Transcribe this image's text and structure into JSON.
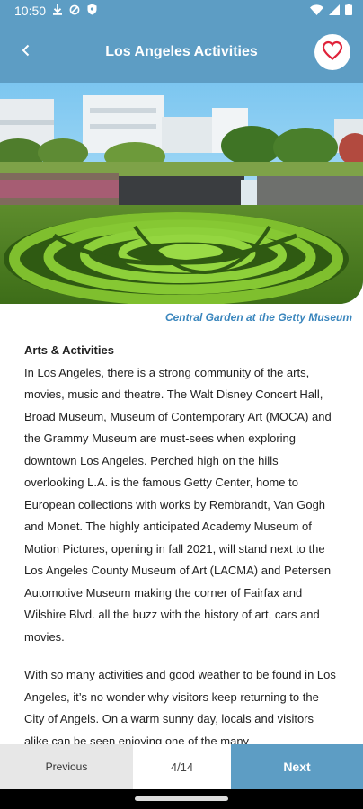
{
  "status_bar": {
    "time": "10:50",
    "left_icons": [
      "download-icon",
      "data-saver-icon",
      "shield-icon"
    ],
    "right_icons": [
      "wifi-icon",
      "signal-icon",
      "battery-icon"
    ]
  },
  "app_bar": {
    "title": "Los Angeles Activities",
    "back_icon": "chevron-left-icon",
    "favorite_icon": "heart-outline-icon",
    "favorite_color": "#e0223a"
  },
  "hero": {
    "caption": "Central Garden at the Getty Museum"
  },
  "article": {
    "heading": "Arts & Activities",
    "paragraphs": [
      "In Los Angeles, there is a strong community of the arts, movies, music and theatre. The Walt Disney Concert Hall, Broad Museum, Museum of Contemporary Art (MOCA) and the Grammy Museum are must-sees when exploring downtown Los Angeles. Perched high on the hills overlooking L.A. is the famous Getty Center, home to European collections with works by Rembrandt, Van Gogh and Monet. The highly anticipated Academy Museum of Motion Pictures, opening in fall 2021, will stand next to the Los Angeles County Museum of Art (LACMA) and Petersen Automotive Museum making the corner of Fairfax and Wilshire Blvd. all the buzz with the history of art, cars and movies.",
      "With so many activities and good weather to be found in Los Angeles, it’s no wonder why visitors keep returning to the City of Angels. On a warm sunny day, locals and visitors alike can be seen enjoying one of the many"
    ]
  },
  "pager": {
    "previous_label": "Previous",
    "page_indicator": "4/14",
    "next_label": "Next"
  },
  "colors": {
    "primary": "#5d9dc4",
    "caption": "#3a86bd"
  }
}
